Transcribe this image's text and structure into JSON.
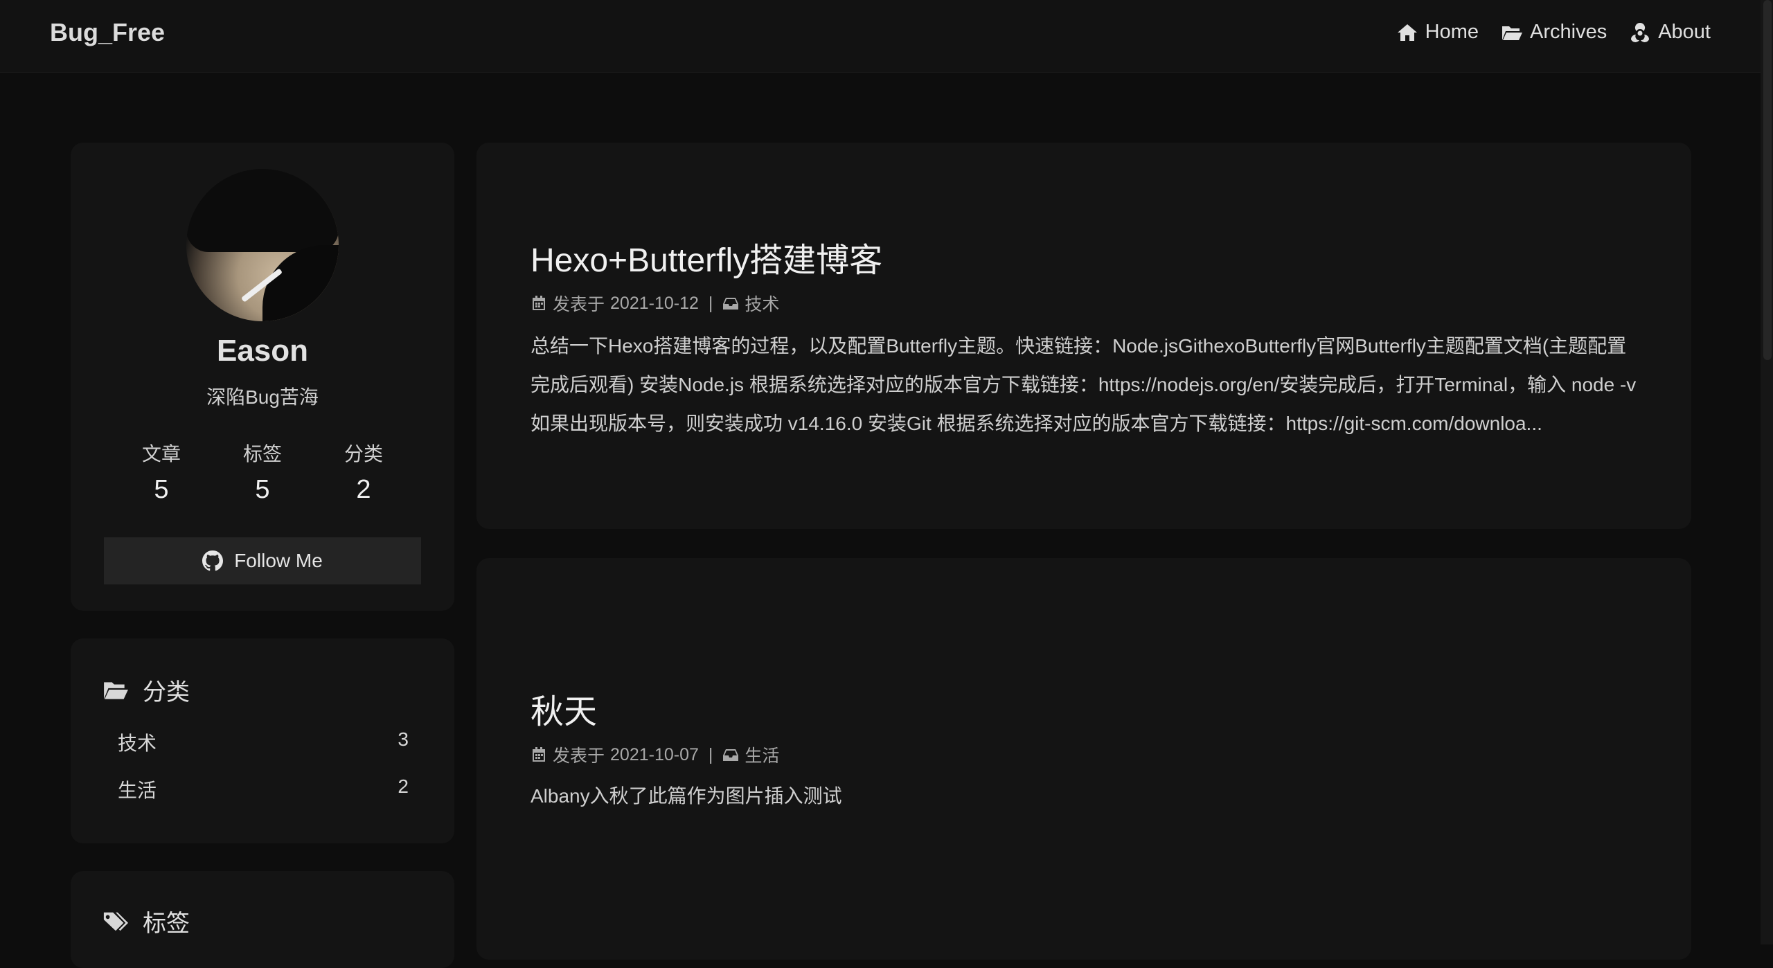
{
  "site": {
    "name": "Bug_Free"
  },
  "nav": {
    "items": [
      {
        "label": "Home",
        "icon": "home-icon"
      },
      {
        "label": "Archives",
        "icon": "folder-open-icon"
      },
      {
        "label": "About",
        "icon": "biohazard-icon"
      }
    ]
  },
  "profile": {
    "name": "Eason",
    "description": "深陷Bug苦海",
    "stats": [
      {
        "label": "文章",
        "value": "5"
      },
      {
        "label": "标签",
        "value": "5"
      },
      {
        "label": "分类",
        "value": "2"
      }
    ],
    "follow_label": "Follow Me"
  },
  "categories_widget": {
    "title": "分类",
    "items": [
      {
        "name": "技术",
        "count": "3"
      },
      {
        "name": "生活",
        "count": "2"
      }
    ]
  },
  "tags_widget": {
    "title": "标签"
  },
  "posts": [
    {
      "title": "Hexo+Butterfly搭建博客",
      "date_prefix": "发表于",
      "date": "2021-10-12",
      "separator": "|",
      "category": "技术",
      "excerpt": "总结一下Hexo搭建博客的过程，以及配置Butterfly主题。快速链接：Node.jsGithexoButterfly官网Butterfly主题配置文档(主题配置完成后观看) 安装Node.js 根据系统选择对应的版本官方下载链接：https://nodejs.org/en/安装完成后，打开Terminal，输入 node -v 如果出现版本号，则安装成功 v14.16.0 安装Git 根据系统选择对应的版本官方下载链接：https://git-scm.com/downloa..."
    },
    {
      "title": "秋天",
      "date_prefix": "发表于",
      "date": "2021-10-07",
      "separator": "|",
      "category": "生活",
      "excerpt": "Albany入秋了此篇作为图片插入测试"
    }
  ]
}
